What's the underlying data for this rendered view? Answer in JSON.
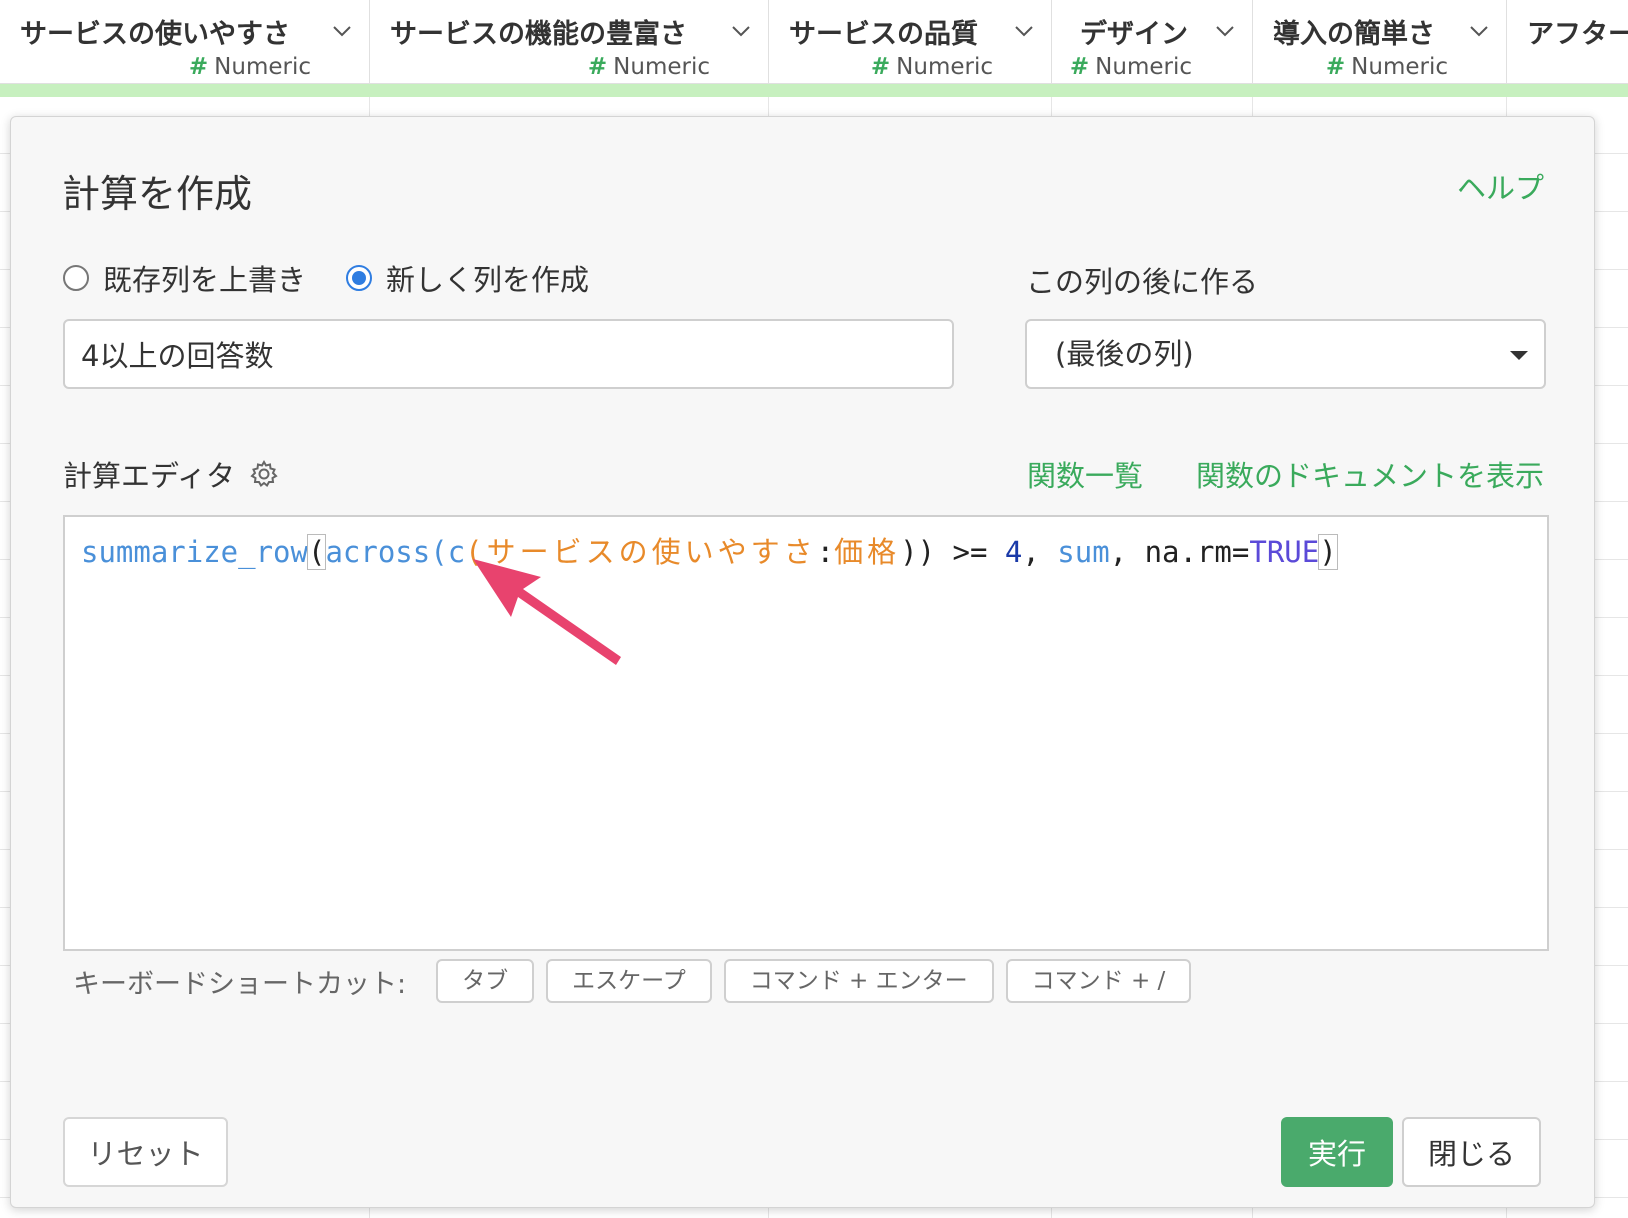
{
  "columns": [
    {
      "name": "サービスの使いやすさ",
      "type": "Numeric"
    },
    {
      "name": "サービスの機能の豊富さ",
      "type": "Numeric"
    },
    {
      "name": "サービスの品質",
      "type": "Numeric"
    },
    {
      "name": "デザイン",
      "type": "Numeric"
    },
    {
      "name": "導入の簡単さ",
      "type": "Numeric"
    },
    {
      "name": "アフター",
      "type": ""
    }
  ],
  "column_type_symbol": "#",
  "dialog": {
    "title": "計算を作成",
    "help_link": "ヘルプ",
    "radio_overwrite": "既存列を上書き",
    "radio_new": "新しく列を作成",
    "selected_mode": "新しく列を作成",
    "column_name_value": "4以上の回答数",
    "after_label": "この列の後に作る",
    "after_select_value": "(最後の列)",
    "editor_label": "計算エディタ",
    "function_list_link": "関数一覧",
    "function_doc_link": "関数のドキュメントを表示",
    "code_tokens": {
      "t1": "summarize_row",
      "t2": "(",
      "t3": "across",
      "t4": "(",
      "t5": "c",
      "t6": "(",
      "t7": "サービスの使いやすさ",
      "t8": ":",
      "t9": "価格",
      "t10": ")) >= ",
      "t11": "4",
      "t12": ", ",
      "t13": "sum",
      "t14": ", na.rm=",
      "t15": "TRUE",
      "t16": ")"
    },
    "shortcut_label": "キーボードショートカット:",
    "shortcuts": [
      "タブ",
      "エスケープ",
      "コマンド + エンター",
      "コマンド + /"
    ],
    "reset_button": "リセット",
    "run_button": "実行",
    "close_button": "閉じる"
  },
  "colors": {
    "accent_green": "#3aaa5c",
    "run_button_bg": "#4aaa6c",
    "radio_blue": "#2f7de1",
    "arrow_pink": "#e8436e",
    "header_green_bar": "#c7f0bf"
  },
  "icons": [
    "chevron-down-icon",
    "gear-icon",
    "arrow-annotation"
  ]
}
